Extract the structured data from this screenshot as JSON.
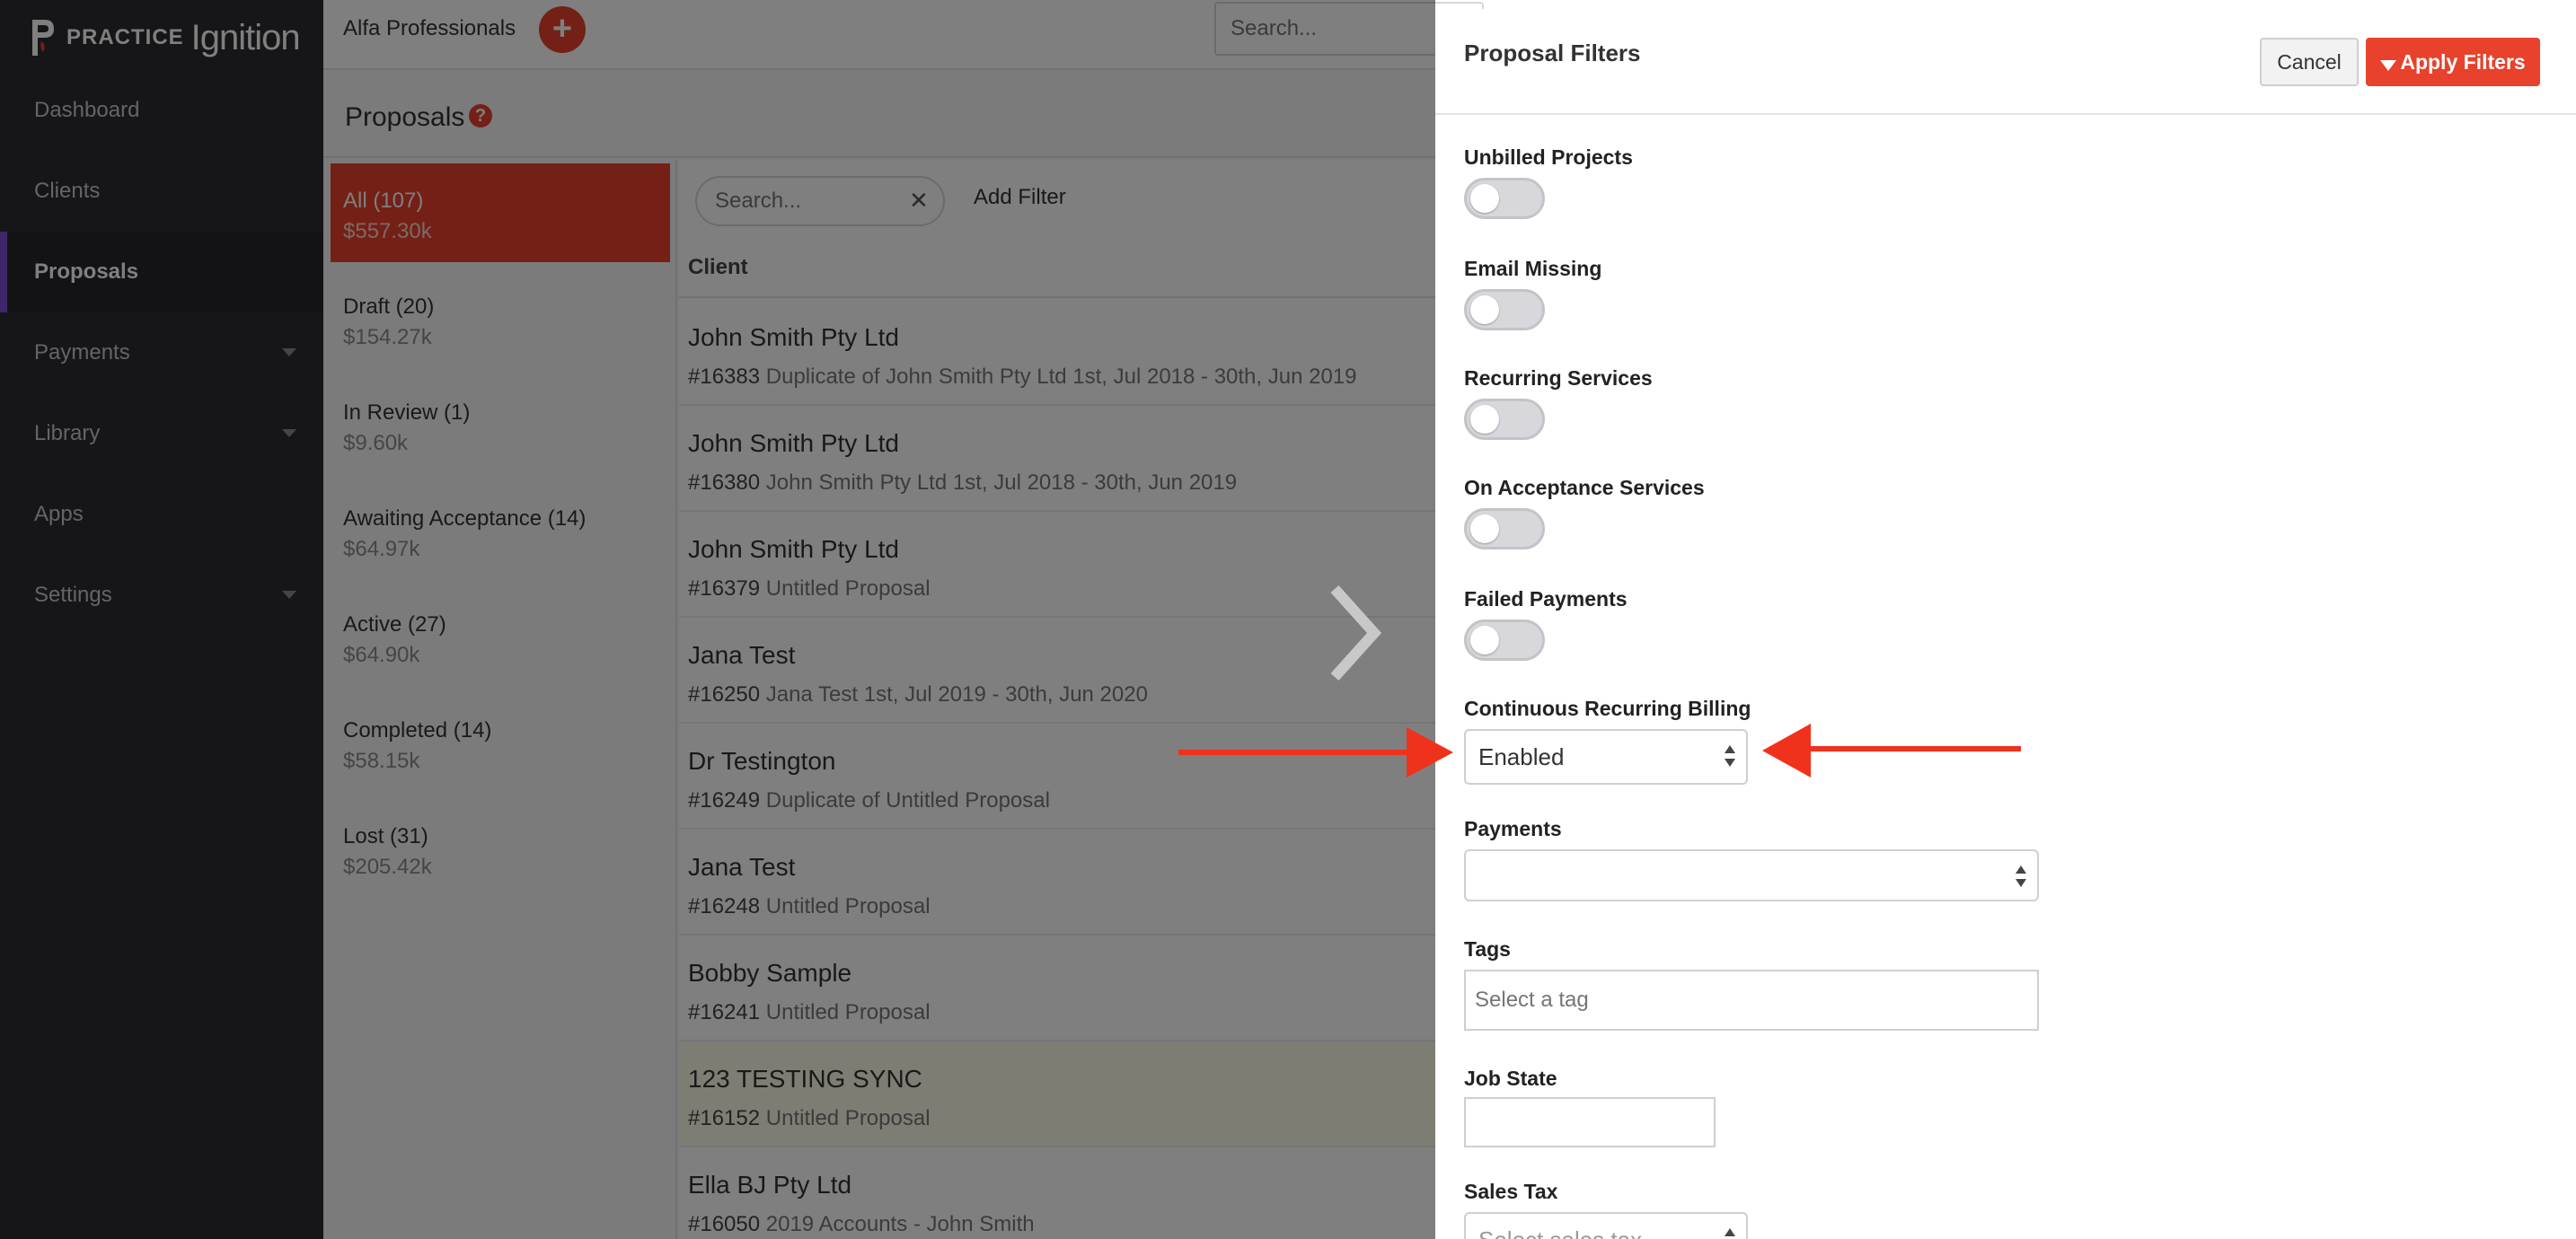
{
  "brand": {
    "practice": "PRACTICE",
    "ignition": "Ignition"
  },
  "sidebar": {
    "items": [
      {
        "label": "Dashboard",
        "has_caret": false
      },
      {
        "label": "Clients",
        "has_caret": false
      },
      {
        "label": "Proposals",
        "has_caret": false,
        "active": true
      },
      {
        "label": "Payments",
        "has_caret": true
      },
      {
        "label": "Library",
        "has_caret": true
      },
      {
        "label": "Apps",
        "has_caret": false
      },
      {
        "label": "Settings",
        "has_caret": true
      }
    ]
  },
  "topbar": {
    "org_name": "Alfa Professionals",
    "add_symbol": "+",
    "search_placeholder": "Search..."
  },
  "page": {
    "title": "Proposals",
    "help_symbol": "?"
  },
  "statuses": [
    {
      "label": "All (107)",
      "amount": "$557.30k",
      "active": true
    },
    {
      "label": "Draft (20)",
      "amount": "$154.27k"
    },
    {
      "label": "In Review (1)",
      "amount": "$9.60k"
    },
    {
      "label": "Awaiting Acceptance (14)",
      "amount": "$64.97k"
    },
    {
      "label": "Active (27)",
      "amount": "$64.90k"
    },
    {
      "label": "Completed (14)",
      "amount": "$58.15k"
    },
    {
      "label": "Lost (31)",
      "amount": "$205.42k"
    }
  ],
  "list": {
    "search_placeholder": "Search...",
    "clear_symbol": "✕",
    "add_filter": "Add Filter",
    "column_client": "Client",
    "rows": [
      {
        "client": "John Smith Pty Ltd",
        "number": "#16383",
        "title": "Duplicate of John Smith Pty Ltd 1st, Jul 2018 - 30th, Jun 2019"
      },
      {
        "client": "John Smith Pty Ltd",
        "number": "#16380",
        "title": "John Smith Pty Ltd 1st, Jul 2018 - 30th, Jun 2019"
      },
      {
        "client": "John Smith Pty Ltd",
        "number": "#16379",
        "title": "Untitled Proposal"
      },
      {
        "client": "Jana Test",
        "number": "#16250",
        "title": "Jana Test 1st, Jul 2019 - 30th, Jun 2020"
      },
      {
        "client": "Dr Testington",
        "number": "#16249",
        "title": "Duplicate of Untitled Proposal"
      },
      {
        "client": "Jana Test",
        "number": "#16248",
        "title": "Untitled Proposal"
      },
      {
        "client": "Bobby Sample",
        "number": "#16241",
        "title": "Untitled Proposal"
      },
      {
        "client": "123 TESTING SYNC",
        "number": "#16152",
        "title": "Untitled Proposal",
        "highlight": true
      },
      {
        "client": "Ella BJ Pty Ltd",
        "number": "#16050",
        "title": "2019 Accounts - John Smith"
      }
    ]
  },
  "filters": {
    "title": "Proposal Filters",
    "cancel": "Cancel",
    "apply": "Apply Filters",
    "toggles": [
      {
        "label": "Unbilled Projects",
        "on": false
      },
      {
        "label": "Email Missing",
        "on": false
      },
      {
        "label": "Recurring Services",
        "on": false
      },
      {
        "label": "On Acceptance Services",
        "on": false
      },
      {
        "label": "Failed Payments",
        "on": false
      }
    ],
    "continuous_billing": {
      "label": "Continuous Recurring Billing",
      "value": "Enabled"
    },
    "payments": {
      "label": "Payments",
      "value": ""
    },
    "tags": {
      "label": "Tags",
      "placeholder": "Select a tag"
    },
    "job_state": {
      "label": "Job State",
      "value": ""
    },
    "sales_tax": {
      "label": "Sales Tax",
      "placeholder": "Select sales tax"
    }
  },
  "colors": {
    "accent": "#e8412c",
    "sidebar": "#2c2c33",
    "active_indicator": "#7b4fd6"
  }
}
